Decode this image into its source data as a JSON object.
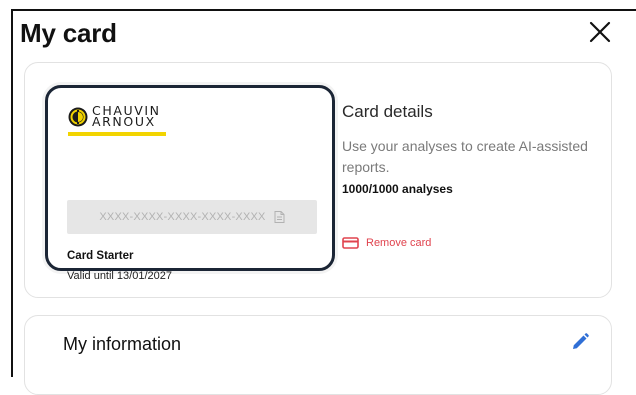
{
  "modal": {
    "title": "My card",
    "close_icon": "close-icon"
  },
  "card": {
    "brand": {
      "line1": "CHAUVIN",
      "line2": "ARNOUX",
      "accent_color": "#f2d400",
      "mark_color": "#1c1c1c"
    },
    "number_masked": "XXXX-XXXX-XXXX-XXXX-XXXX",
    "copy_icon": "copy-icon",
    "plan": "Card Starter",
    "validity": "Valid until 13/01/2027",
    "border_color": "#1b2535"
  },
  "details": {
    "title": "Card details",
    "description": "Use your analyses to create AI-assisted reports.",
    "analyses_count": "1000/1000 analyses",
    "remove_label": "Remove card",
    "remove_icon": "card-remove-icon",
    "remove_color": "#e0434e"
  },
  "info": {
    "title": "My information",
    "edit_icon": "pencil-icon",
    "edit_color": "#2f6fd6"
  }
}
